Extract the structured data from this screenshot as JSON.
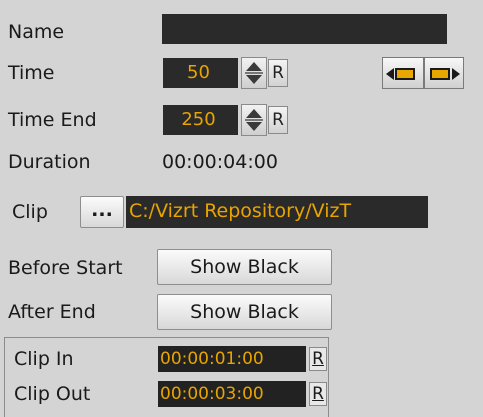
{
  "name": {
    "label": "Name",
    "value": ""
  },
  "time": {
    "label": "Time",
    "value": "50",
    "reset_label": "R"
  },
  "time_end": {
    "label": "Time End",
    "value": "250",
    "reset_label": "R"
  },
  "duration": {
    "label": "Duration",
    "value": "00:00:04:00"
  },
  "clip": {
    "label": "Clip",
    "browse_label": "...",
    "path": "C:/Vizrt Repository/VizT"
  },
  "before_start": {
    "label": "Before Start",
    "value": "Show Black"
  },
  "after_end": {
    "label": "After End",
    "value": "Show Black"
  },
  "clip_in": {
    "label": "Clip In",
    "value": "00:00:01:00",
    "reset_label": "R"
  },
  "clip_out": {
    "label": "Clip Out",
    "value": "00:00:03:00",
    "reset_label": "R"
  },
  "colors": {
    "field_bg": "#2a2a2a",
    "field_text": "#e8a400",
    "panel_bg": "#d4d4d4"
  }
}
